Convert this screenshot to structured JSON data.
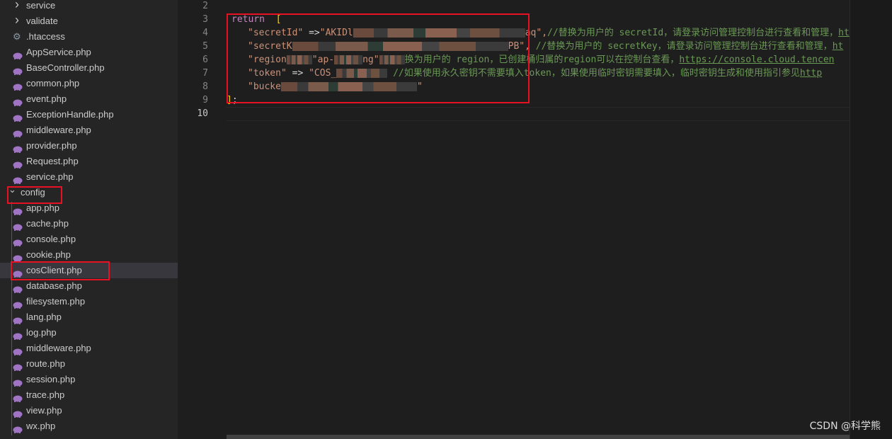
{
  "explorer": {
    "items": [
      {
        "label": "service",
        "type": "folder"
      },
      {
        "label": "validate",
        "type": "folder"
      },
      {
        "label": ".htaccess",
        "type": "gear"
      },
      {
        "label": "AppService.php",
        "type": "php"
      },
      {
        "label": "BaseController.php",
        "type": "php"
      },
      {
        "label": "common.php",
        "type": "php"
      },
      {
        "label": "event.php",
        "type": "php"
      },
      {
        "label": "ExceptionHandle.php",
        "type": "php"
      },
      {
        "label": "middleware.php",
        "type": "php"
      },
      {
        "label": "provider.php",
        "type": "php"
      },
      {
        "label": "Request.php",
        "type": "php"
      },
      {
        "label": "service.php",
        "type": "php"
      },
      {
        "label": "config",
        "type": "folder-open"
      },
      {
        "label": "app.php",
        "type": "php"
      },
      {
        "label": "cache.php",
        "type": "php"
      },
      {
        "label": "console.php",
        "type": "php"
      },
      {
        "label": "cookie.php",
        "type": "php"
      },
      {
        "label": "cosClient.php",
        "type": "php",
        "selected": true
      },
      {
        "label": "database.php",
        "type": "php"
      },
      {
        "label": "filesystem.php",
        "type": "php"
      },
      {
        "label": "lang.php",
        "type": "php"
      },
      {
        "label": "log.php",
        "type": "php"
      },
      {
        "label": "middleware.php",
        "type": "php"
      },
      {
        "label": "route.php",
        "type": "php"
      },
      {
        "label": "session.php",
        "type": "php"
      },
      {
        "label": "trace.php",
        "type": "php"
      },
      {
        "label": "view.php",
        "type": "php"
      },
      {
        "label": "wx.php",
        "type": "php"
      }
    ]
  },
  "editor": {
    "line_numbers": [
      "2",
      "3",
      "4",
      "5",
      "6",
      "7",
      "8",
      "9",
      "10"
    ],
    "current_line": "10",
    "code": {
      "return_kw": "return",
      "open_bracket": "[",
      "l4_key": "\"secretId\"",
      "l4_arrow": " =>",
      "l4_val_start": "\"AKIDl",
      "l4_val_end": "aq\",",
      "l4_comment": "//替换为用户的 secretId，请登录访问管理控制台进行查看和管理，",
      "l4_url": "ht",
      "l5_key": "\"secretK",
      "l5_val_end": "PB\",",
      "l5_comment": " //替换为用户的 secretKey，请登录访问管理控制台进行查看和管理，",
      "l5_url": "ht",
      "l6_key": "\"region",
      "l6_val": "\"ap-",
      "l6_val_end": "ng\"",
      "l6_comment": "换为用户的 region，已创建桶归属的region可以在控制台查看，",
      "l6_url": "https://console.cloud.tencen",
      "l7_key": "\"token\"",
      "l7_arrow": " => ",
      "l7_val": "\"COS_",
      "l7_comment": " //如果使用永久密钥不需要填入token，如果使用临时密钥需要填入，临时密钥生成和使用指引参见",
      "l7_url": "http",
      "l8_key": "\"bucke",
      "l8_val_end": "\"",
      "close_bracket": "]",
      "semicolon": ";"
    }
  },
  "watermark": "CSDN @科学熊",
  "colors": {
    "highlight_box": "#e81123",
    "keyword": "#c586c0",
    "string": "#ce9178",
    "comment": "#6a9955",
    "php_icon": "#a074c4"
  }
}
